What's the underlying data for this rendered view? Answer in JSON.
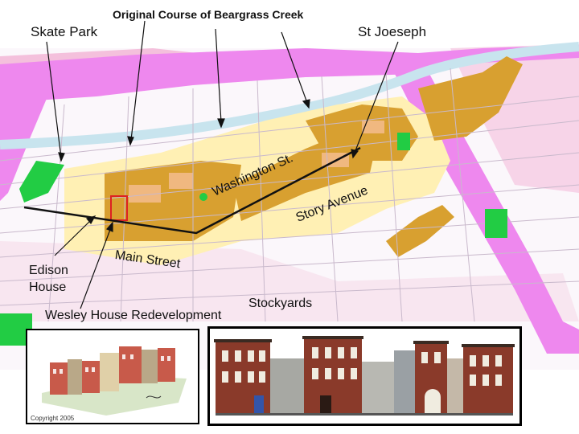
{
  "labels": {
    "skate_park": "Skate Park",
    "creek": "Original Course of Beargrass Creek",
    "st_joeseph": "St Joeseph",
    "washington_st": "Washington St.",
    "story_avenue": "Story Avenue",
    "main_street": "Main Street",
    "edison_house": "Edison House",
    "stockyards": "Stockyards",
    "wesley_house": "Wesley House Redevelopment"
  },
  "inset_left": {
    "copyright": "Copyright 2005"
  },
  "colors": {
    "background": "#ffffff",
    "interstate": "#ee88ee",
    "river": "#c8e4ee",
    "historic_district": "#d8a030",
    "historic_district_light": "#fff0b4",
    "industrial": "#f2b8d8",
    "park": "#22cc44",
    "route_line": "#111111",
    "redevelopment_outline": "#dd2222"
  }
}
